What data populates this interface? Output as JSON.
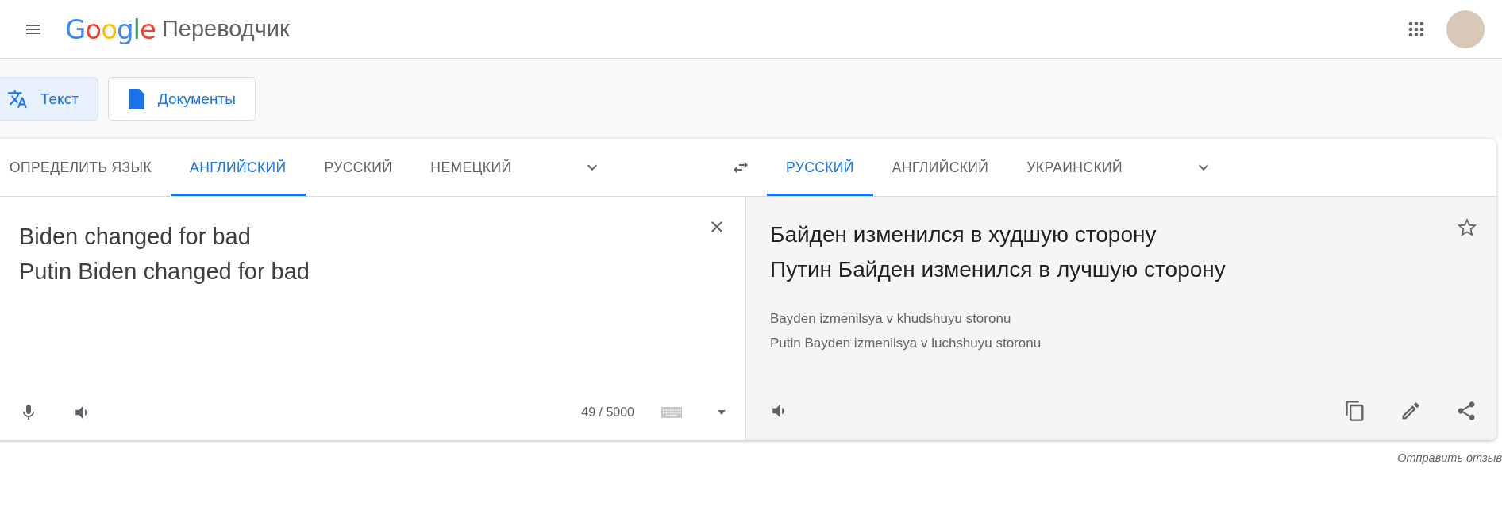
{
  "header": {
    "logo": "Google",
    "product": "Переводчик"
  },
  "modes": [
    {
      "kind": "text",
      "label": "Текст",
      "selected": true
    },
    {
      "kind": "documents",
      "label": "Документы",
      "selected": false
    }
  ],
  "source_languages": [
    {
      "label": "ОПРЕДЕЛИТЬ ЯЗЫК",
      "selected": false
    },
    {
      "label": "АНГЛИЙСКИЙ",
      "selected": true
    },
    {
      "label": "РУССКИЙ",
      "selected": false
    },
    {
      "label": "НЕМЕЦКИЙ",
      "selected": false
    }
  ],
  "target_languages": [
    {
      "label": "РУССКИЙ",
      "selected": true
    },
    {
      "label": "АНГЛИЙСКИЙ",
      "selected": false
    },
    {
      "label": "УКРАИНСКИЙ",
      "selected": false
    }
  ],
  "source_text": "Biden changed for bad\nPutin Biden changed for bad",
  "char_count": "49 / 5000",
  "translation": "Байден изменился в худшую сторону\nПутин Байден изменился в лучшую сторону",
  "transliteration": "Bayden izmenilsya v khudshuyu storonu\nPutin Bayden izmenilsya v luchshuyu storonu",
  "feedback_link": "Отправить отзыв"
}
